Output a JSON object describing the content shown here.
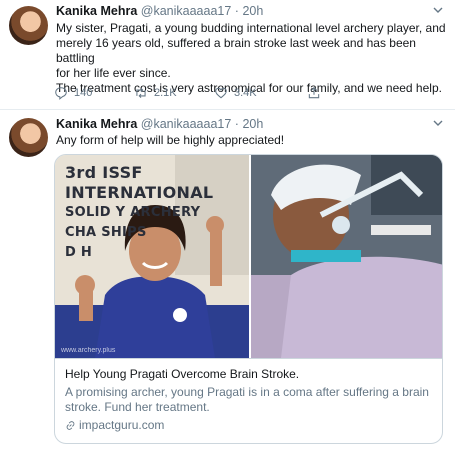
{
  "tweet1": {
    "name": "Kanika Mehra",
    "handle": "@kanikaaaaa17",
    "separator": "·",
    "time": "20h",
    "lines": [
      "My sister, Pragati, a young budding international level archery player, and",
      "merely 16 years old, suffered a brain stroke last week and has been battling",
      "for her life ever since.",
      "The treatment cost is very astronomical for our family, and we need help."
    ],
    "reply_count": "140",
    "retweet_count": "2.1K",
    "like_count": "3.4K"
  },
  "tweet2": {
    "name": "Kanika Mehra",
    "handle": "@kanikaaaaa17",
    "separator": "·",
    "time": "20h",
    "text": "Any form of help will be highly appreciated!",
    "card": {
      "poster_lines": [
        "3rd ISSF",
        "INTERNATIONAL",
        "SOLID    Y ARCHERY",
        "CHA      SHIPS",
        "D H"
      ],
      "watermark": "www.archery.plus",
      "title": "Help Young Pragati Overcome Brain Stroke.",
      "description_lines": [
        "A promising archer, young Pragati is in a coma after suffering a brain",
        "stroke. Fund her treatment."
      ],
      "domain": "impactguru.com"
    }
  },
  "colors": {
    "text_primary": "#14171a",
    "text_secondary": "#657786",
    "border": "#ccd6dd"
  },
  "icons": [
    "chevron-down-icon",
    "reply-icon",
    "retweet-icon",
    "like-icon",
    "share-icon",
    "link-icon"
  ]
}
